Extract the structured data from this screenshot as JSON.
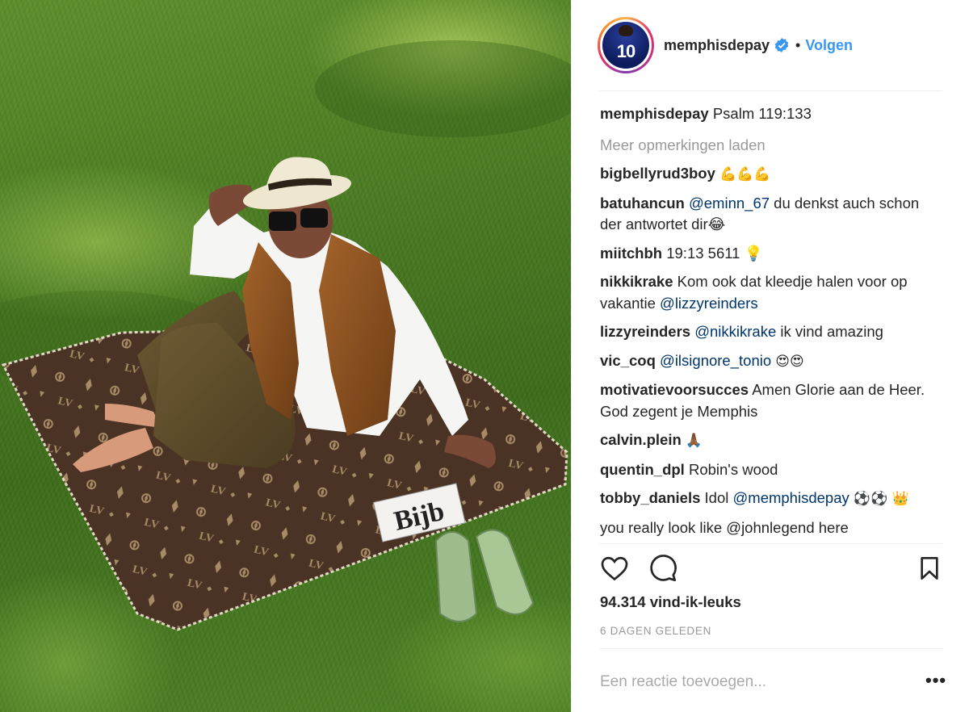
{
  "post": {
    "username": "memphisdepay",
    "verified": true,
    "follow_label": "Volgen",
    "avatar_number": "10"
  },
  "photo": {
    "book_text": "Bijb"
  },
  "caption": {
    "user": "memphisdepay",
    "text": "Psalm 119:133"
  },
  "load_more_label": "Meer opmerkingen laden",
  "comments": [
    {
      "user": "bigbellyrud3boy",
      "mention": "",
      "text": "💪💪💪"
    },
    {
      "user": "batuhancun",
      "mention": "@eminn_67",
      "text": "du denkst auch schon der antwortet dir😂"
    },
    {
      "user": "miitchbh",
      "mention": "",
      "text": "19:13 5611 💡"
    },
    {
      "user": "nikkikrake",
      "mention": "",
      "text": "Kom ook dat kleedje halen voor op vakantie",
      "mention_after": "@lizzyreinders"
    },
    {
      "user": "lizzyreinders",
      "mention": "@nikkikrake",
      "text": "ik vind amazing"
    },
    {
      "user": "vic_coq",
      "mention": "@ilsignore_tonio",
      "text": "😍😍"
    },
    {
      "user": "motivatievoorsucces",
      "mention": "",
      "text": "Amen Glorie aan de Heer. God zegent je Memphis"
    },
    {
      "user": "calvin.plein",
      "mention": "",
      "text": "🙏🏾"
    },
    {
      "user": "quentin_dpl",
      "mention": "",
      "text": "Robin's wood"
    },
    {
      "user": "tobby_daniels",
      "mention": "",
      "text": "Idol",
      "mention_after": "@memphisdepay",
      "text_after": "⚽⚽ 👑"
    },
    {
      "user": "",
      "mention": "",
      "text": "you really look like @johnlegend here"
    }
  ],
  "likes": "94.314 vind-ik-leuks",
  "date": "6 DAGEN GELEDEN",
  "add_comment_placeholder": "Een reactie toevoegen...",
  "more_label": "•••",
  "icons": {
    "like": "heart-icon",
    "comment": "comment-bubble-icon",
    "save": "bookmark-icon",
    "verified": "verified-badge-icon"
  },
  "colors": {
    "link": "#3897f0",
    "mention": "#003569",
    "muted": "#999999",
    "text": "#262626"
  }
}
